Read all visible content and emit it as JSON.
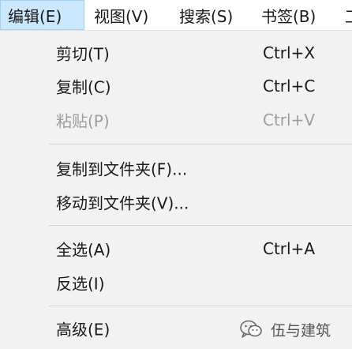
{
  "menubar": {
    "items": [
      {
        "label": "编辑(E)"
      },
      {
        "label": "视图(V)"
      },
      {
        "label": "搜索(S)"
      },
      {
        "label": "书签(B)"
      },
      {
        "label": "工"
      }
    ]
  },
  "menu": {
    "cut": {
      "label": "剪切(T)",
      "shortcut": "Ctrl+X"
    },
    "copy": {
      "label": "复制(C)",
      "shortcut": "Ctrl+C"
    },
    "paste": {
      "label": "粘贴(P)",
      "shortcut": "Ctrl+V"
    },
    "copy_to_folder": {
      "label": "复制到文件夹(F)..."
    },
    "move_to_folder": {
      "label": "移动到文件夹(V)..."
    },
    "select_all": {
      "label": "全选(A)",
      "shortcut": "Ctrl+A"
    },
    "invert_selection": {
      "label": "反选(I)"
    },
    "advanced": {
      "label": "高级(E)"
    }
  },
  "watermark": {
    "text": "伍与建筑"
  },
  "icons": {
    "watermark_logo": "wechat-icon"
  },
  "colors": {
    "menubar_active_bg": "#cce8ff",
    "menubar_active_border": "#99d1ff",
    "menu_bg": "#f2f2f2",
    "disabled_text": "#9e9e9e"
  }
}
